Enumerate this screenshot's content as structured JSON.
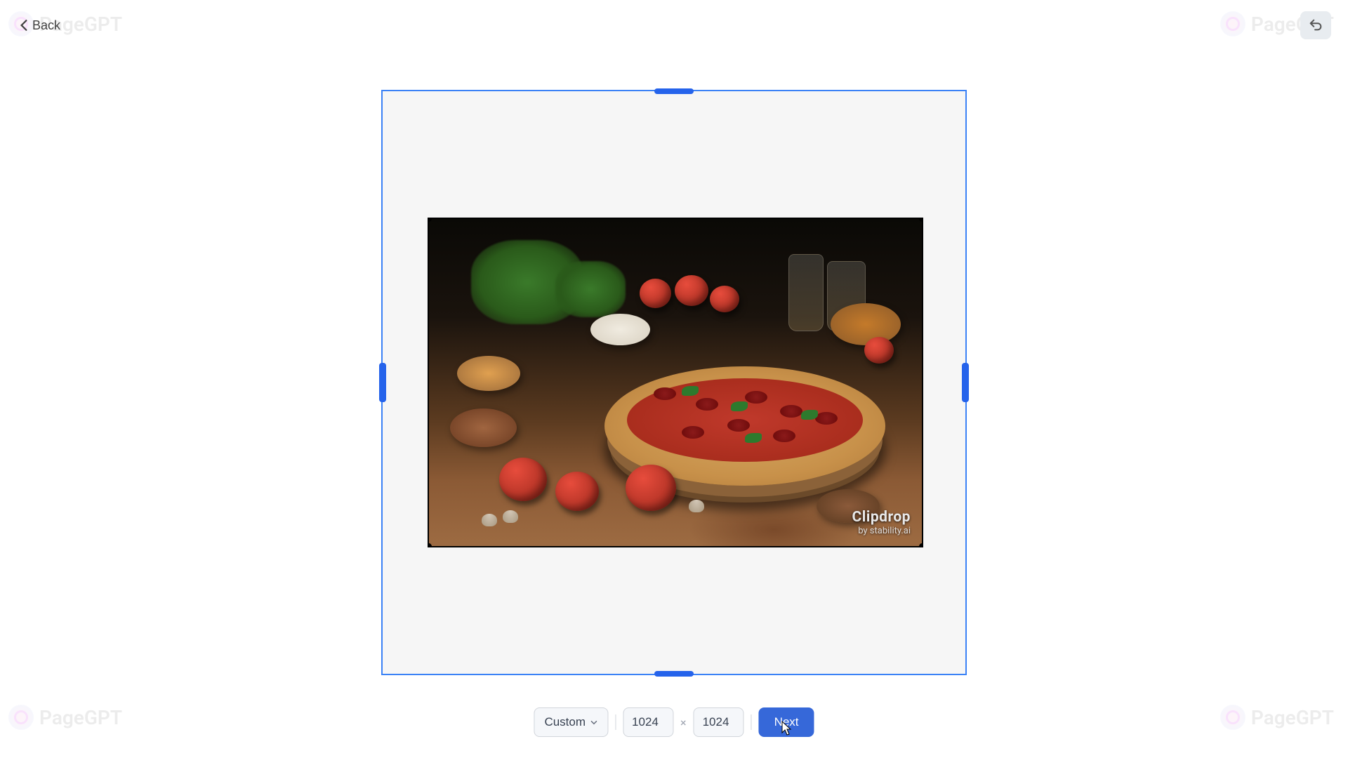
{
  "header": {
    "back_label": "Back"
  },
  "watermark": {
    "brand_text": "PageGPT"
  },
  "image_watermark": {
    "title": "Clipdrop",
    "subtitle": "by stability.ai"
  },
  "toolbar": {
    "aspect_label": "Custom",
    "width_value": "1024",
    "height_value": "1024",
    "separator": "×",
    "next_label": "Next"
  },
  "colors": {
    "accent": "#2563eb",
    "primary_button": "#3668d9"
  }
}
